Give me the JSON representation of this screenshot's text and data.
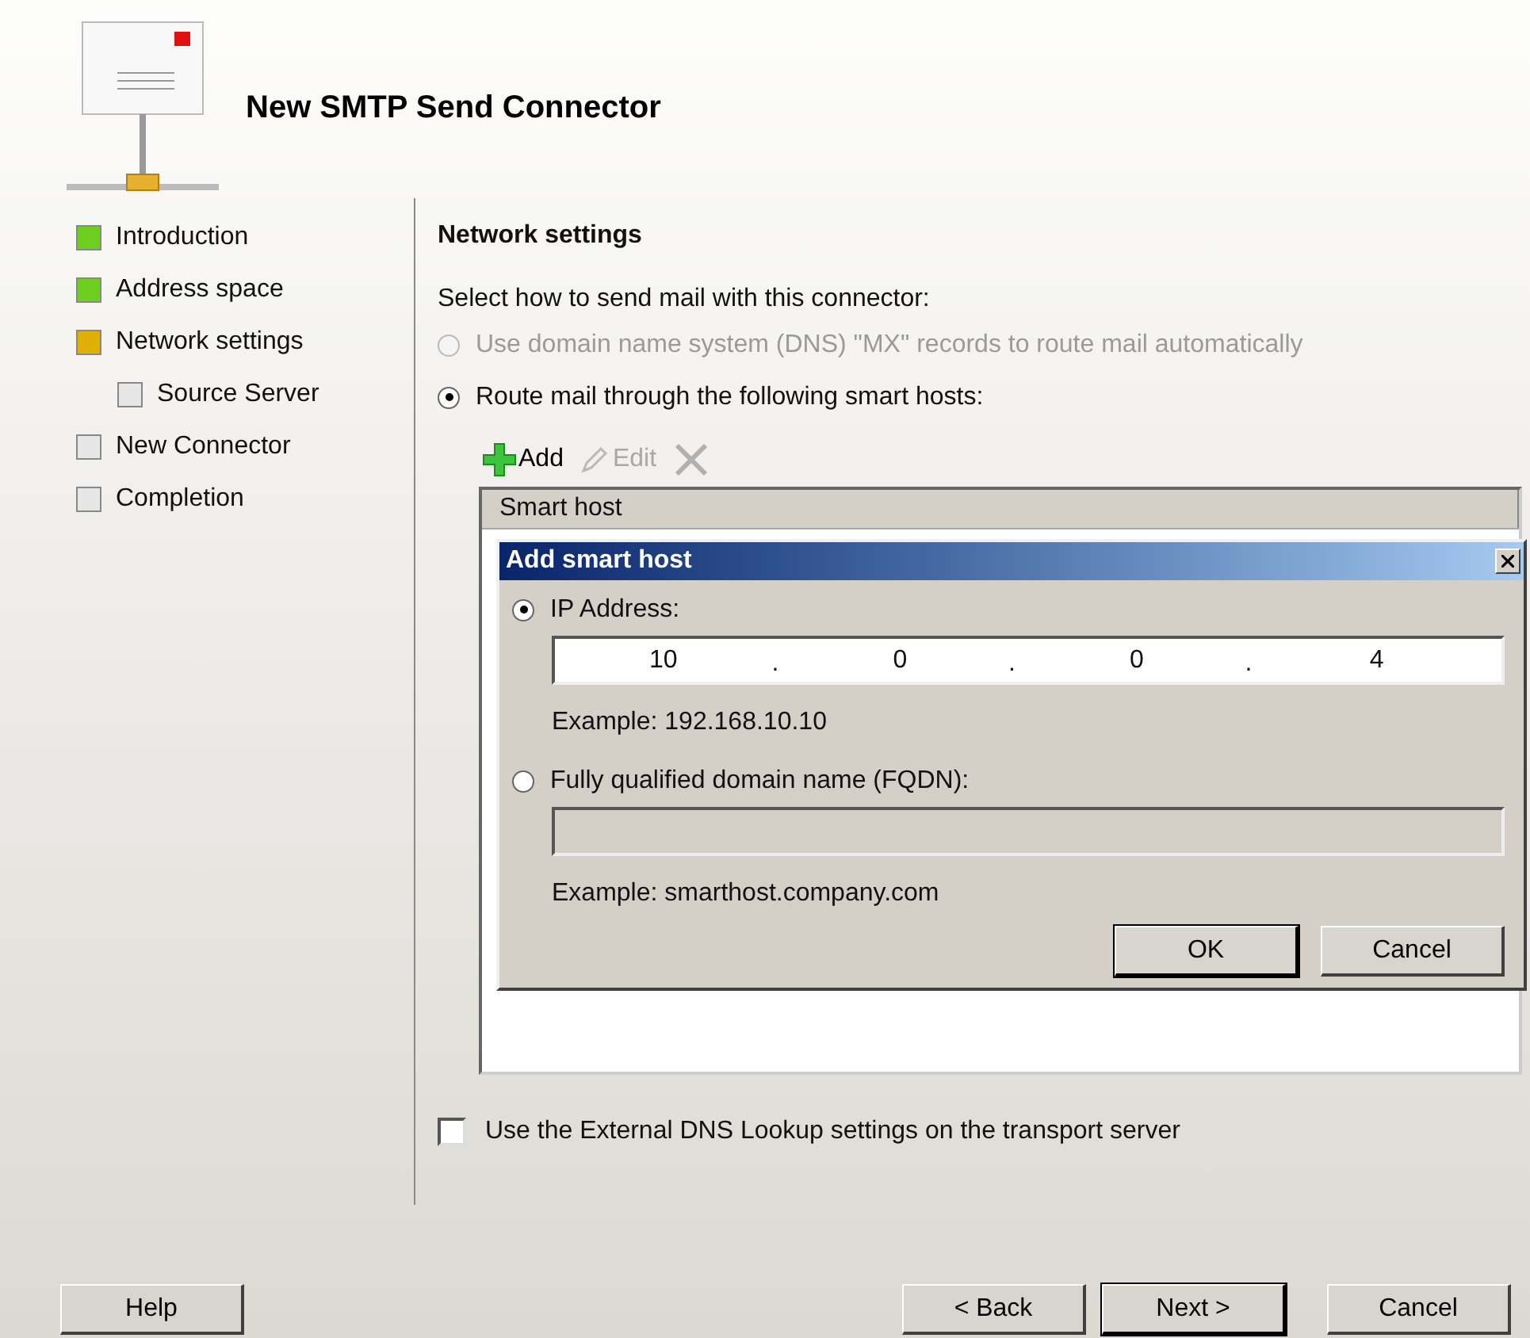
{
  "wizard": {
    "title": "New SMTP Send Connector"
  },
  "steps": [
    {
      "label": "Introduction",
      "color": "#6fcf1f"
    },
    {
      "label": "Address space",
      "color": "#6fcf1f"
    },
    {
      "label": "Network settings",
      "color": "#e0b000",
      "children": [
        {
          "label": "Source Server",
          "color": "#e6e6e6"
        }
      ]
    },
    {
      "label": "New Connector",
      "color": "#e6e6e6"
    },
    {
      "label": "Completion",
      "color": "#e6e6e6"
    }
  ],
  "section": {
    "heading": "Network settings",
    "prompt": "Select how to send mail with this connector:",
    "options": [
      {
        "label": "Use domain name system (DNS) \"MX\" records to route mail automatically",
        "selected": false,
        "disabled": true
      },
      {
        "label": "Route mail through the following smart hosts:",
        "selected": true,
        "disabled": false
      }
    ]
  },
  "toolbar": [
    {
      "kind": "add",
      "label": "Add",
      "disabled": false
    },
    {
      "kind": "edit",
      "label": "Edit",
      "disabled": true
    },
    {
      "kind": "remove",
      "disabled": true
    }
  ],
  "smart_host_list": {
    "columns": [
      "Smart host"
    ]
  },
  "dialog": {
    "title": "Add smart host",
    "options": [
      {
        "kind": "ip",
        "label": "IP Address:",
        "selected": true,
        "octets": [
          "10",
          "0",
          "0",
          "4"
        ],
        "separator": ".",
        "example": "Example: 192.168.10.10"
      },
      {
        "kind": "text",
        "label": "Fully qualified domain name (FQDN):",
        "selected": false,
        "example": "Example: smarthost.company.com"
      }
    ],
    "buttons": [
      {
        "label": "OK",
        "default": true
      },
      {
        "label": "Cancel",
        "default": false
      }
    ]
  },
  "dns_checkbox": {
    "label": "Use the External DNS Lookup settings on the transport server",
    "checked": false
  },
  "footer_buttons": [
    {
      "label": "Help",
      "default": false
    },
    {
      "label": "< Back",
      "default": false
    },
    {
      "label": "Next >",
      "default": true
    },
    {
      "label": "Cancel",
      "default": false
    }
  ]
}
